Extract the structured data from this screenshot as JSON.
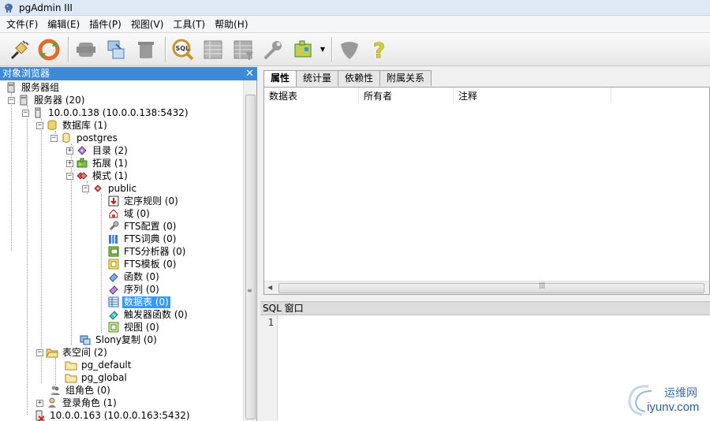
{
  "window": {
    "title": "pgAdmin III"
  },
  "menu": [
    "文件(F)",
    "编辑(E)",
    "插件(P)",
    "视图(V)",
    "工具(T)",
    "帮助(H)"
  ],
  "toolbar": {
    "buttons": [
      "connect-icon",
      "refresh-icon",
      "server-icon",
      "view-data-icon",
      "delete-icon",
      "sql-query-icon",
      "table-grid-icon",
      "table-filter-icon",
      "wrench-icon",
      "plugin-icon",
      "shield-icon",
      "help-icon"
    ]
  },
  "browser": {
    "title": "对象浏览器",
    "close": "✕",
    "nodes": {
      "server_groups": "服务器组",
      "servers": "服务器 (20)",
      "server1": "10.0.0.138 (10.0.0.138:5432)",
      "databases": "数据库 (1)",
      "postgres": "postgres",
      "catalogs": "目录 (2)",
      "extensions": "拓展 (1)",
      "schemas": "模式 (1)",
      "public": "public",
      "collations": "定序规则 (0)",
      "domains": "域 (0)",
      "fts_configs": "FTS配置 (0)",
      "fts_dicts": "FTS词典 (0)",
      "fts_parsers": "FTS分析器 (0)",
      "fts_templates": "FTS模板 (0)",
      "functions": "函数 (0)",
      "sequences": "序列 (0)",
      "tables": "数据表 (0)",
      "trigger_functions": "触发器函数 (0)",
      "views": "视图 (0)",
      "slony": "Slony复制 (0)",
      "tablespaces": "表空间 (2)",
      "pg_default": "pg_default",
      "pg_global": "pg_global",
      "group_roles": "组角色 (0)",
      "login_roles": "登录角色 (1)",
      "server2": "10.0.0.163 (10.0.0.163:5432)"
    }
  },
  "properties": {
    "tabs": [
      "属性",
      "统计量",
      "依赖性",
      "附属关系"
    ],
    "columns": [
      "数据表",
      "所有者",
      "注释"
    ]
  },
  "sql": {
    "title": "SQL 窗口",
    "line_number": "1"
  },
  "watermark": {
    "cn": "运维网",
    "en": "iyunv.com"
  }
}
